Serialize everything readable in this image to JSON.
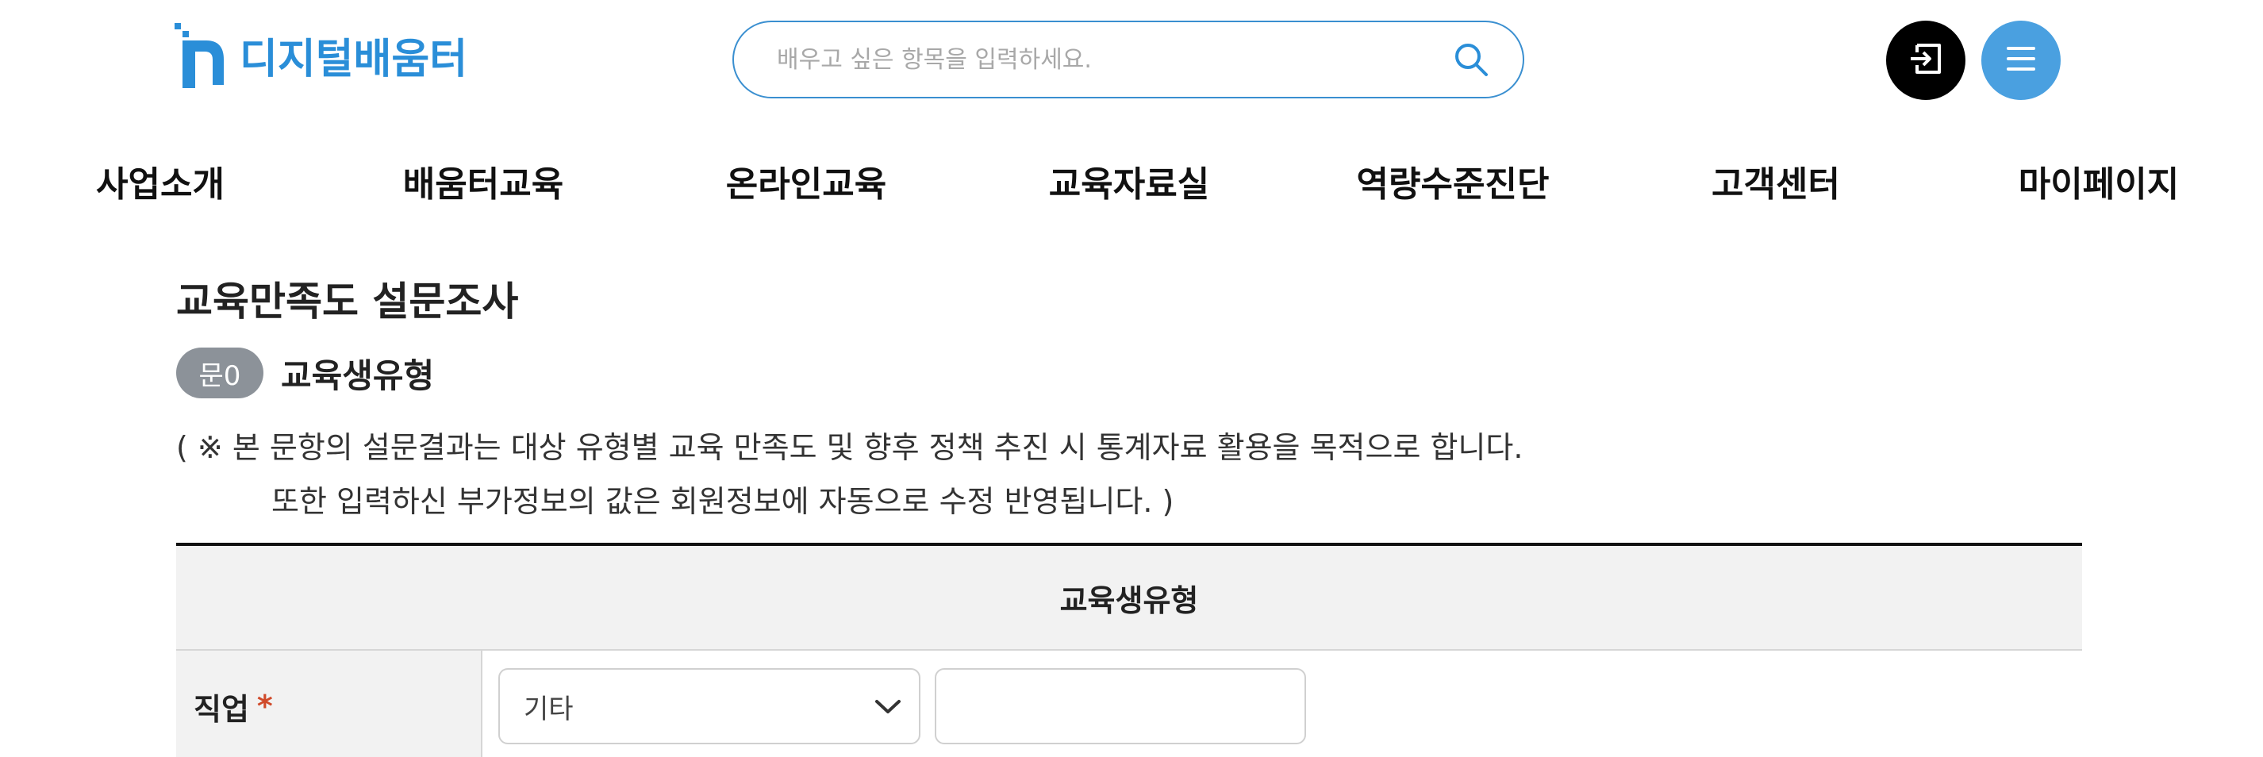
{
  "header": {
    "logo_text": "디지털배움터",
    "search_placeholder": "배우고 싶은 항목을 입력하세요.",
    "login_icon": "login-icon",
    "menu_icon": "hamburger-menu-icon",
    "colors": {
      "brand": "#2a8ed8",
      "menu_button": "#4aa0e0",
      "login_button": "#000000"
    }
  },
  "nav": {
    "items": [
      {
        "label": "사업소개"
      },
      {
        "label": "배움터교육"
      },
      {
        "label": "온라인교육"
      },
      {
        "label": "교육자료실"
      },
      {
        "label": "역량수준진단"
      },
      {
        "label": "고객센터"
      },
      {
        "label": "마이페이지"
      }
    ]
  },
  "main": {
    "title": "교육만족도 설문조사",
    "question": {
      "badge": "문0",
      "title": "교육생유형"
    },
    "notice_line1": "( ※ 본 문항의 설문결과는 대상 유형별 교육 만족도 및 향후 정책 추진 시 통계자료 활용을 목적으로 합니다.",
    "notice_line2": "또한 입력하신 부가정보의 값은 회원정보에 자동으로 수정 반영됩니다. )",
    "table": {
      "header": "교육생유형",
      "rows": [
        {
          "label": "직업",
          "required_mark": "*",
          "select_value": "기타",
          "text_value": ""
        }
      ]
    }
  }
}
